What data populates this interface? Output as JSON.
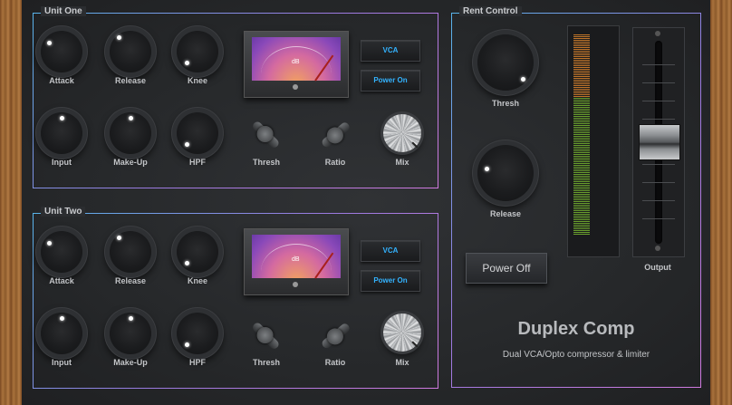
{
  "unit_one": {
    "title": "Unit One",
    "row1": [
      "Attack",
      "Release",
      "Knee"
    ],
    "row2": [
      "Input",
      "Make-Up",
      "HPF",
      "Thresh",
      "Ratio",
      "Mix"
    ],
    "meter_db": "dB",
    "vca": "VCA",
    "power": "Power On"
  },
  "unit_two": {
    "title": "Unit Two",
    "row1": [
      "Attack",
      "Release",
      "Knee"
    ],
    "row2": [
      "Input",
      "Make-Up",
      "HPF",
      "Thresh",
      "Ratio",
      "Mix"
    ],
    "meter_db": "dB",
    "vca": "VCA",
    "power": "Power On"
  },
  "rent": {
    "title": "Rent Control",
    "thresh": "Thresh",
    "release": "Release",
    "power_off": "Power Off",
    "output": "Output"
  },
  "brand": {
    "name": "Duplex Comp",
    "tagline": "Dual VCA/Opto compressor & limiter"
  },
  "colors": {
    "accent_blue": "#33b3ff",
    "frame_start": "#58b4ea",
    "frame_end": "#d07adf"
  }
}
